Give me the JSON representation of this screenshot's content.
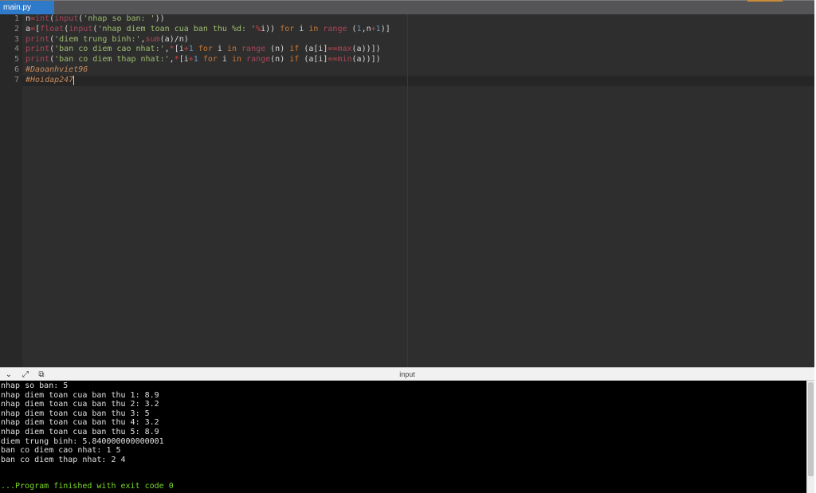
{
  "tabs": [
    {
      "label": "main.py",
      "active": true
    }
  ],
  "editor": {
    "line_numbers": [
      "1",
      "2",
      "3",
      "4",
      "5",
      "6",
      "7"
    ],
    "active_line": 7
  },
  "console": {
    "title": "input",
    "icons": [
      "chevron-down-icon",
      "expand-icon",
      "copy-icon"
    ],
    "lines": [
      "nhap so ban: 5",
      "nhap diem toan cua ban thu 1: 8.9",
      "nhap diem toan cua ban thu 2: 3.2",
      "nhap diem toan cua ban thu 3: 5",
      "nhap diem toan cua ban thu 4: 3.2",
      "nhap diem toan cua ban thu 5: 8.9",
      "diem trung binh: 5.840000000000001",
      "ban co diem cao nhat: 1 5",
      "ban co diem thap nhat: 2 4"
    ],
    "finished": "...Program finished with exit code 0"
  },
  "colors": {
    "tab_active": "#2f7ac8",
    "editor_bg": "#2e2e2e",
    "keyword": "#cc7832",
    "builtin": "#a9475a",
    "string": "#9fbd71",
    "number": "#6897bb",
    "comment": "#c98a5b",
    "finished": "#7cd82a"
  },
  "code_tokens": {
    "l1": [
      "n",
      "=",
      "int",
      "(",
      "input",
      "(",
      "'nhap so ban: '",
      "))"
    ],
    "l2": [
      "a",
      "=",
      "[",
      "float",
      "(",
      "input",
      "(",
      "'nhap diem toan cua ban thu %d: '",
      "%",
      "i",
      ")) ",
      "for",
      " i ",
      "in",
      " ",
      "range",
      " (",
      "1",
      ",n",
      "+",
      "1",
      ")]"
    ],
    "l3": [
      "print",
      "(",
      "'diem trung binh:'",
      ",",
      "sum",
      "(a)/n)"
    ],
    "l4": [
      "print",
      "(",
      "'ban co diem cao nhat:'",
      ",",
      "*",
      "[i",
      "+",
      "1",
      " ",
      "for",
      " i ",
      "in",
      " ",
      "range",
      " (n) ",
      "if",
      " (a[i]",
      "==",
      "max",
      "(a))])"
    ],
    "l5": [
      "print",
      "(",
      "'ban co diem thap nhat:'",
      ",",
      "*",
      "[i",
      "+",
      "1",
      " ",
      "for",
      " i ",
      "in",
      " ",
      "range",
      "(n) ",
      "if",
      " (a[i]",
      "==",
      "min",
      "(a))])"
    ],
    "l6": [
      "#Daoanhviet96"
    ],
    "l7": [
      "#Hoidap247"
    ]
  }
}
